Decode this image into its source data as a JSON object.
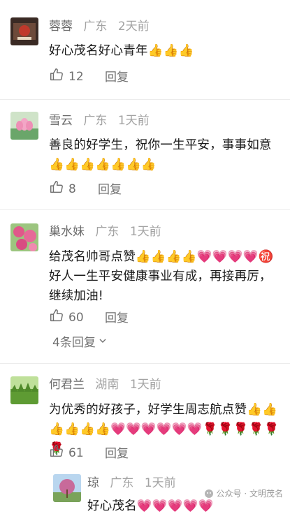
{
  "comments": [
    {
      "name": "蓉蓉",
      "location": "广东",
      "time": "2天前",
      "text": "好心茂名好心青年👍👍👍",
      "likes": "12",
      "reply_label": "回复"
    },
    {
      "name": "雪云",
      "location": "广东",
      "time": "1天前",
      "text": "善良的好学生，祝你一生平安，事事如意👍👍👍👍👍👍👍",
      "likes": "8",
      "reply_label": "回复"
    },
    {
      "name": "巢水妹",
      "location": "广东",
      "time": "1天前",
      "text": "给茂名帅哥点赞👍👍👍👍💗💗💗💗㊗️好人一生平安健康事业有成，再接再厉，继续加油!",
      "likes": "60",
      "reply_label": "回复",
      "more_replies": "4条回复"
    },
    {
      "name": "何君兰",
      "location": "湖南",
      "time": "1天前",
      "text": "为优秀的好孩子，好学生周志航点赞👍👍👍👍👍👍💗💗💗💗💗💗🌹🌹🌹🌹🌹🌹",
      "likes": "61",
      "reply_label": "回复"
    }
  ],
  "sub_reply": {
    "name": "琼",
    "location": "广东",
    "time": "1天前",
    "text": "好心茂名💗💗💗💗💗"
  },
  "watermark": "公众号 · 文明茂名",
  "colors": {
    "name": "#6b6b6b",
    "meta": "#a3a3a3",
    "text": "#1a1a1a",
    "action": "#707070"
  }
}
